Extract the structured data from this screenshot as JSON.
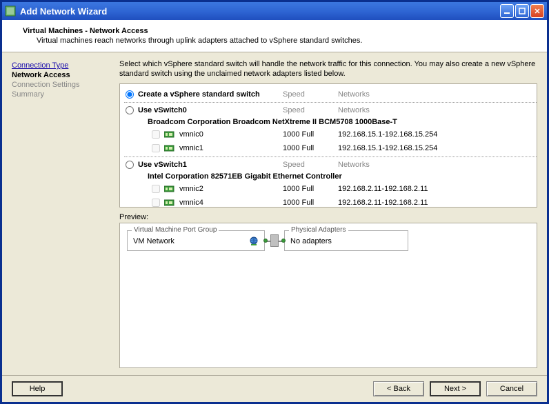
{
  "window": {
    "title": "Add Network Wizard"
  },
  "header": {
    "title": "Virtual Machines - Network Access",
    "subtitle": "Virtual machines reach networks through uplink adapters attached to vSphere standard switches."
  },
  "nav": {
    "items": [
      {
        "label": "Connection Type",
        "state": "link"
      },
      {
        "label": "Network Access",
        "state": "active"
      },
      {
        "label": "Connection Settings",
        "state": "disabled"
      },
      {
        "label": "Summary",
        "state": "disabled"
      }
    ]
  },
  "main": {
    "instruction": "Select which vSphere standard switch will handle the network traffic for this connection. You may also create a new vSphere standard switch using the unclaimed network adapters listed below.",
    "col_speed": "Speed",
    "col_networks": "Networks",
    "options": [
      {
        "selected": true,
        "label": "Create a vSphere standard switch",
        "adapters": []
      },
      {
        "selected": false,
        "label": "Use vSwitch0",
        "adapter_title": "Broadcom Corporation Broadcom NetXtreme II BCM5708 1000Base-T",
        "adapters": [
          {
            "name": "vmnic0",
            "speed": "1000 Full",
            "networks": "192.168.15.1-192.168.15.254"
          },
          {
            "name": "vmnic1",
            "speed": "1000 Full",
            "networks": "192.168.15.1-192.168.15.254"
          }
        ]
      },
      {
        "selected": false,
        "label": "Use vSwitch1",
        "adapter_title": "Intel Corporation 82571EB Gigabit Ethernet Controller",
        "adapters": [
          {
            "name": "vmnic2",
            "speed": "1000 Full",
            "networks": "192.168.2.11-192.168.2.11"
          },
          {
            "name": "vmnic4",
            "speed": "1000 Full",
            "networks": "192.168.2.11-192.168.2.11"
          }
        ]
      }
    ]
  },
  "preview": {
    "label": "Preview:",
    "vmpg_legend": "Virtual Machine Port Group",
    "vmpg_value": "VM Network",
    "pa_legend": "Physical Adapters",
    "pa_value": "No adapters"
  },
  "footer": {
    "help": "Help",
    "back": "< Back",
    "next": "Next >",
    "cancel": "Cancel"
  }
}
